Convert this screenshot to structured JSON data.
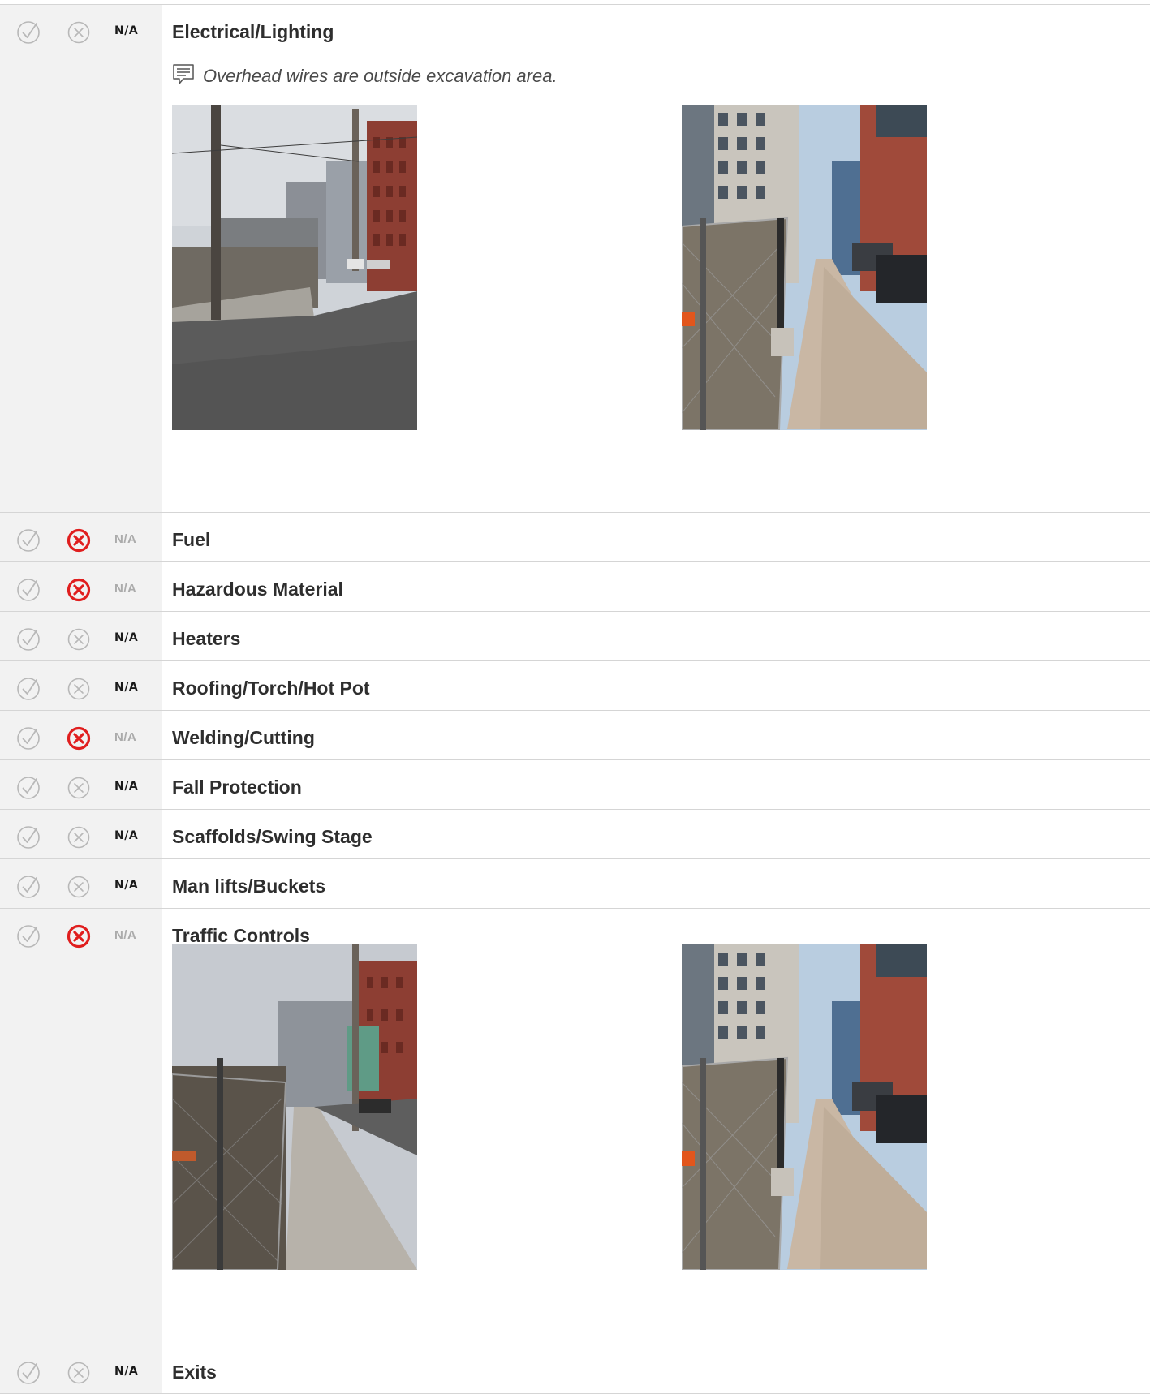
{
  "items": [
    {
      "title": "Electrical/Lighting",
      "status": "na",
      "na_label": "N/A",
      "comment": "Overhead wires are outside excavation area.",
      "photos": [
        "street-corner-utility-pole-photo",
        "sidewalk-fence-photo"
      ]
    },
    {
      "title": "Fuel",
      "status": "fail",
      "na_label": "N/A"
    },
    {
      "title": "Hazardous Material",
      "status": "fail",
      "na_label": "N/A"
    },
    {
      "title": "Heaters",
      "status": "na",
      "na_label": "N/A"
    },
    {
      "title": "Roofing/Torch/Hot Pot",
      "status": "na",
      "na_label": "N/A"
    },
    {
      "title": "Welding/Cutting",
      "status": "fail",
      "na_label": "N/A"
    },
    {
      "title": "Fall Protection",
      "status": "na",
      "na_label": "N/A"
    },
    {
      "title": "Scaffolds/Swing Stage",
      "status": "na",
      "na_label": "N/A"
    },
    {
      "title": "Man lifts/Buckets",
      "status": "na",
      "na_label": "N/A"
    },
    {
      "title": "Traffic Controls",
      "status": "fail",
      "na_label": "N/A",
      "photos": [
        "fenced-lot-sidewalk-photo",
        "sidewalk-fence-photo"
      ]
    },
    {
      "title": "Exits",
      "status": "na",
      "na_label": "N/A"
    }
  ],
  "colors": {
    "status_column_bg": "#f2f2f2",
    "fail_active": "#e01e1e",
    "icon_inactive": "#b8b8b8",
    "na_active": "#1a1a1a",
    "na_inactive": "#ababab",
    "divider": "#d5d5d5"
  },
  "icons": {
    "pass": "check-circle-icon",
    "fail": "x-circle-icon",
    "comment": "comment-icon"
  }
}
